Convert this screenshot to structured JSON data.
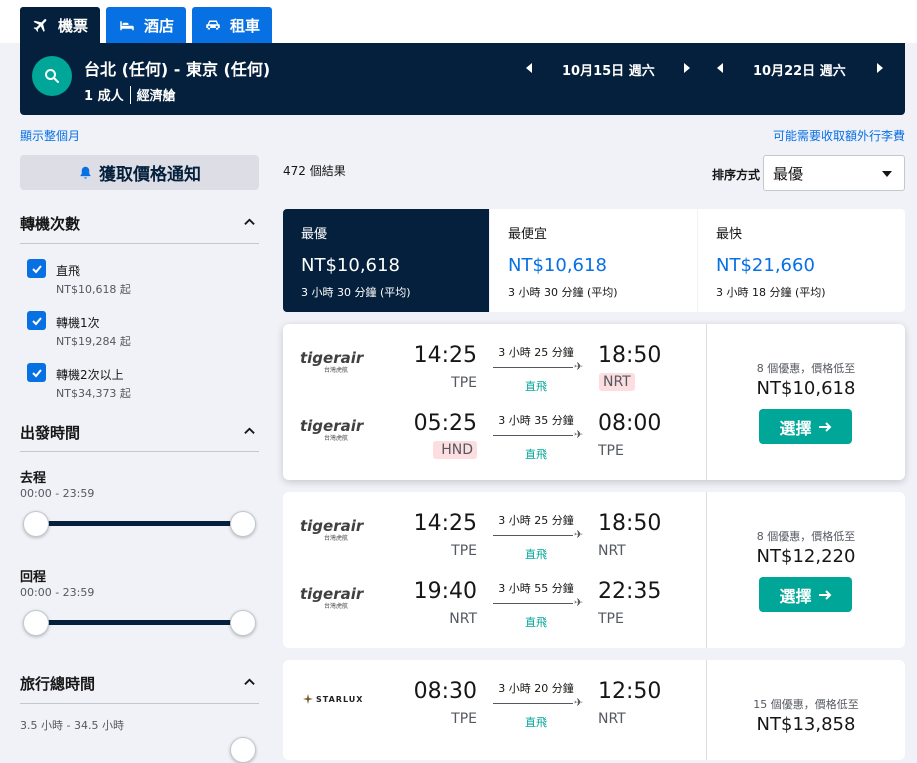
{
  "tabs": [
    {
      "label": "機票",
      "icon": "plane-icon"
    },
    {
      "label": "酒店",
      "icon": "bed-icon"
    },
    {
      "label": "租車",
      "icon": "car-icon"
    }
  ],
  "search": {
    "route": "台北 (任何) - 東京 (任何)",
    "passengers": "1 成人",
    "cabin": "經濟艙",
    "depart_date": "10月15日 週六",
    "return_date": "10月22日 週六"
  },
  "links": {
    "show_month": "顯示整個月",
    "baggage_fee": "可能需要收取額外行李費"
  },
  "price_alert": {
    "label": "獲取價格通知"
  },
  "filters": {
    "stops": {
      "title": "轉機次數",
      "options": [
        {
          "label": "直飛",
          "sub": "NT$10,618 起",
          "checked": true
        },
        {
          "label": "轉機1次",
          "sub": "NT$19,284 起",
          "checked": true
        },
        {
          "label": "轉機2次以上",
          "sub": "NT$34,373 起",
          "checked": true
        }
      ]
    },
    "departure_time": {
      "title": "出發時間",
      "outbound_label": "去程",
      "outbound_range": "00:00 - 23:59",
      "return_label": "回程",
      "return_range": "00:00 - 23:59"
    },
    "duration": {
      "title": "旅行總時間",
      "range": "3.5 小時 - 34.5 小時"
    }
  },
  "results": {
    "count": "472 個結果",
    "sort_label": "排序方式",
    "sort_value": "最優"
  },
  "summary": [
    {
      "label": "最優",
      "price": "NT$10,618",
      "duration": "3 小時 30 分鐘 (平均)"
    },
    {
      "label": "最便宜",
      "price": "NT$10,618",
      "duration": "3 小時 30 分鐘 (平均)"
    },
    {
      "label": "最快",
      "price": "NT$21,660",
      "duration": "3 小時 18 分鐘 (平均)"
    }
  ],
  "itineraries": [
    {
      "deals": "8 個優惠，價格低至",
      "price": "NT$10,618",
      "button": "選擇",
      "legs": [
        {
          "airline": "tigerair",
          "airline_sub": "台灣虎航",
          "dep_time": "14:25",
          "dep_code": "TPE",
          "duration": "3 小時 25 分鐘",
          "stops": "直飛",
          "arr_time": "18:50",
          "arr_code": "NRT"
        },
        {
          "airline": "tigerair",
          "airline_sub": "台灣虎航",
          "dep_time": "05:25",
          "dep_code": "HND",
          "duration": "3 小時 35 分鐘",
          "stops": "直飛",
          "arr_time": "08:00",
          "arr_code": "TPE"
        }
      ]
    },
    {
      "deals": "8 個優惠，價格低至",
      "price": "NT$12,220",
      "button": "選擇",
      "legs": [
        {
          "airline": "tigerair",
          "airline_sub": "台灣虎航",
          "dep_time": "14:25",
          "dep_code": "TPE",
          "duration": "3 小時 25 分鐘",
          "stops": "直飛",
          "arr_time": "18:50",
          "arr_code": "NRT"
        },
        {
          "airline": "tigerair",
          "airline_sub": "台灣虎航",
          "dep_time": "19:40",
          "dep_code": "NRT",
          "duration": "3 小時 55 分鐘",
          "stops": "直飛",
          "arr_time": "22:35",
          "arr_code": "TPE"
        }
      ]
    },
    {
      "deals": "15 個優惠，價格低至",
      "price": "NT$13,858",
      "legs": [
        {
          "airline": "STARLUX",
          "dep_time": "08:30",
          "dep_code": "TPE",
          "duration": "3 小時 20 分鐘",
          "stops": "直飛",
          "arr_time": "12:50",
          "arr_code": "NRT"
        }
      ]
    }
  ],
  "colors": {
    "navy": "#05203c",
    "blue": "#0770e3",
    "teal": "#00a698",
    "warn_bg": "#fcdde0"
  }
}
